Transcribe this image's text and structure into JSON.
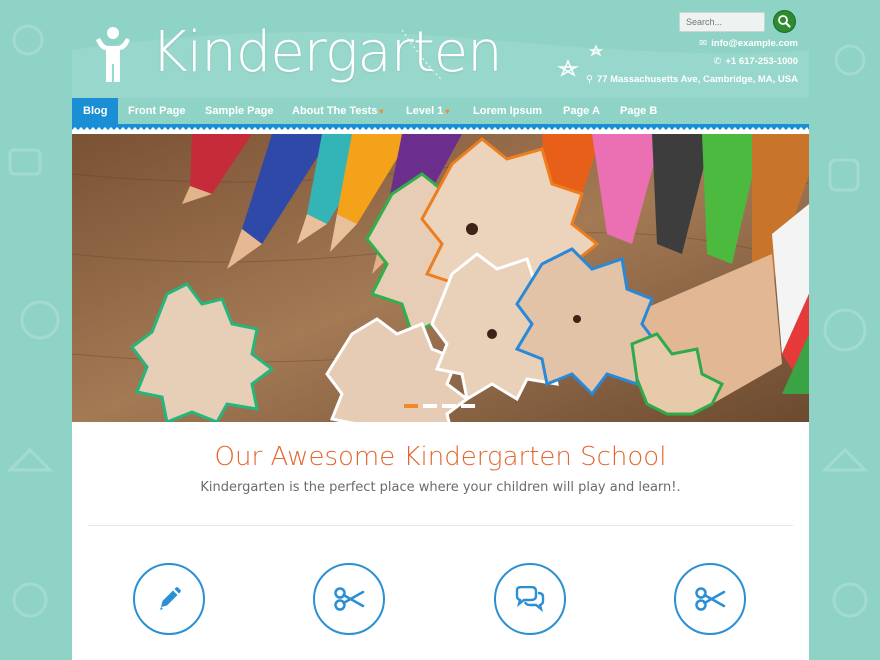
{
  "site": {
    "title": "Kindergarten",
    "search_placeholder": "Search...",
    "email": "info@example.com",
    "phone": "+1 617-253-1000",
    "address": "77 Massachusetts Ave, Cambridge, MA, USA"
  },
  "nav": {
    "items": [
      {
        "label": "Blog",
        "active": true,
        "has_submenu": false
      },
      {
        "label": "Front Page",
        "active": false,
        "has_submenu": false
      },
      {
        "label": "Sample Page",
        "active": false,
        "has_submenu": false
      },
      {
        "label": "About The Tests",
        "active": false,
        "has_submenu": true
      },
      {
        "label": "Level 1",
        "active": false,
        "has_submenu": true
      },
      {
        "label": "Lorem Ipsum",
        "active": false,
        "has_submenu": false
      },
      {
        "label": "Page A",
        "active": false,
        "has_submenu": false
      },
      {
        "label": "Page B",
        "active": false,
        "has_submenu": false
      }
    ]
  },
  "slider": {
    "dot_count": 4,
    "active_index": 0
  },
  "content": {
    "heading": "Our Awesome Kindergarten School",
    "subheading": "Kindergarten is the perfect place where your children will play and learn!."
  },
  "features": [
    {
      "icon": "pencil-icon"
    },
    {
      "icon": "scissors-icon"
    },
    {
      "icon": "comments-icon"
    },
    {
      "icon": "scissors-icon"
    }
  ],
  "colors": {
    "background": "#8fd3c6",
    "nav_active": "#1a8fd6",
    "heading_orange": "#e4652e",
    "feature_blue": "#2a8fd3",
    "search_button_green": "#2e8b2f",
    "caret_orange": "#f08a28"
  }
}
